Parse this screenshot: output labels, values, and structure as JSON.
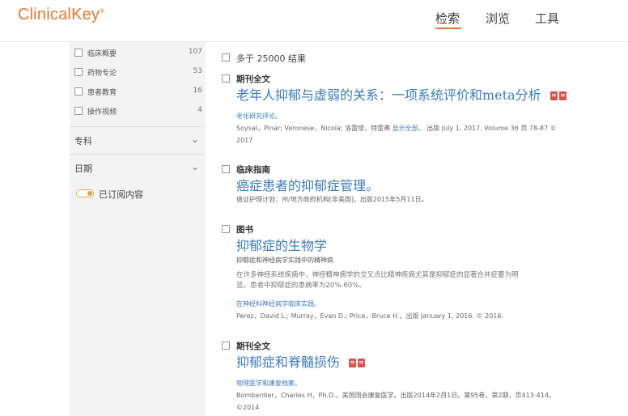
{
  "header": {
    "logo": "ClinicalKey",
    "logo_mark": "®",
    "nav": [
      "检索",
      "浏览",
      "工具"
    ],
    "active_nav": "检索",
    "accent_color": "#e8772e"
  },
  "sidebar": {
    "filters": [
      {
        "label": "临床概要",
        "count": "107"
      },
      {
        "label": "药物专论",
        "count": "53"
      },
      {
        "label": "患者教育",
        "count": "16"
      },
      {
        "label": "操作视频",
        "count": "4"
      }
    ],
    "facets": [
      {
        "label": "专科",
        "icon": "chevron-down-icon"
      },
      {
        "label": "日期",
        "icon": "chevron-down-icon"
      }
    ],
    "toggle_label": "已订阅内容"
  },
  "main": {
    "result_count": "多于 25000 结果",
    "results": [
      {
        "type": "期刊全文",
        "title": "老年人抑郁与虚弱的关系：一项系统评价和meta分析",
        "has_pdf": true,
        "subtitle": "老化研究评论。",
        "meta_line1": "Soysal，Pinar; Veronese，Nicola; 洛雷塔，特雷弗",
        "meta_link": "显示全部。",
        "meta_line1_tail": " 出版 July 1, 2017. Volume 36 页 78-87 ©",
        "meta_line2": "2017"
      },
      {
        "type": "临床指南",
        "title": "癌症患者的抑郁症管理。",
        "has_pdf": false,
        "meta_line1": "循证护理计划；州/地方政府机构[非美国]，出版2015年5月11日。"
      },
      {
        "type": "图书",
        "title": "抑郁症的生物学",
        "has_pdf": false,
        "subtitle_dark": "抑郁症和神经病学实践中的精神病",
        "abstract_line1": "在许多神经系统疾病中，神经精神病学的交叉点比精神疾病尤其是抑郁症的显著合并症要为明",
        "abstract_line2": "显。患者中抑郁症的患病率为20%-60%。",
        "link_small": "在神经科神经病学临床实践。",
        "meta_line1": "Perez，David L.; Murray，Evan D.; Price，Bruce H.，出版 January 1, 2016. © 2016."
      },
      {
        "type": "期刊全文",
        "title": "抑郁症和脊髓损伤",
        "has_pdf": true,
        "subtitle": "物理医学和康复档案。",
        "meta_line1": "Bombardier，Charles H，Ph.D.，美国国会康复医学。出版2014年2月1日。第95卷，第2期，页413-414。",
        "meta_line2": "©2014"
      }
    ]
  }
}
